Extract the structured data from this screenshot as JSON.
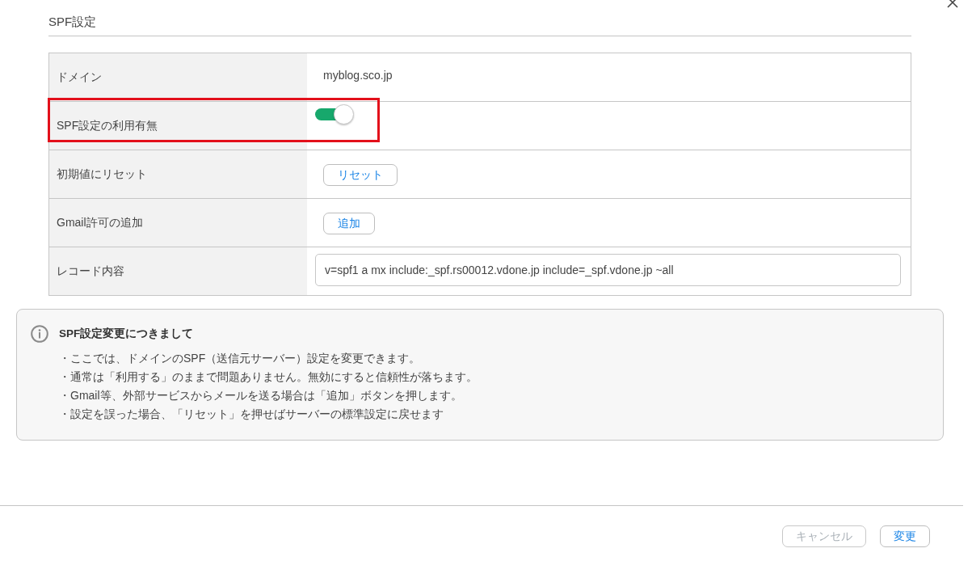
{
  "dialog": {
    "title": "SPF設定"
  },
  "settings": {
    "rows": [
      {
        "kind": "text",
        "label": "ドメイン",
        "value": "myblog.sco.jp",
        "highlighted": false
      },
      {
        "kind": "toggle",
        "label": "SPF設定の利用有無",
        "on": true,
        "highlighted": true
      },
      {
        "kind": "button",
        "label": "初期値にリセット",
        "button": "リセット",
        "highlighted": false
      },
      {
        "kind": "button",
        "label": "Gmail許可の追加",
        "button": "追加",
        "highlighted": false
      },
      {
        "kind": "field",
        "label": "レコード内容",
        "value": "v=spf1 a mx include:_spf.rs00012.vdone.jp include=_spf.vdone.jp ~all",
        "highlighted": false
      }
    ]
  },
  "notice": {
    "title": "SPF設定変更につきまして",
    "items": [
      "・ここでは、ドメインのSPF（送信元サーバー）設定を変更できます。",
      "・通常は「利用する」のままで問題ありません。無効にすると信頼性が落ちます。",
      "・Gmail等、外部サービスからメールを送る場合は「追加」ボタンを押します。",
      "・設定を誤った場合、「リセット」を押せばサーバーの標準設定に戻せます"
    ]
  },
  "footer": {
    "buttons": [
      {
        "label": "キャンセル",
        "disabled": true
      },
      {
        "label": "変更",
        "disabled": false
      }
    ]
  }
}
